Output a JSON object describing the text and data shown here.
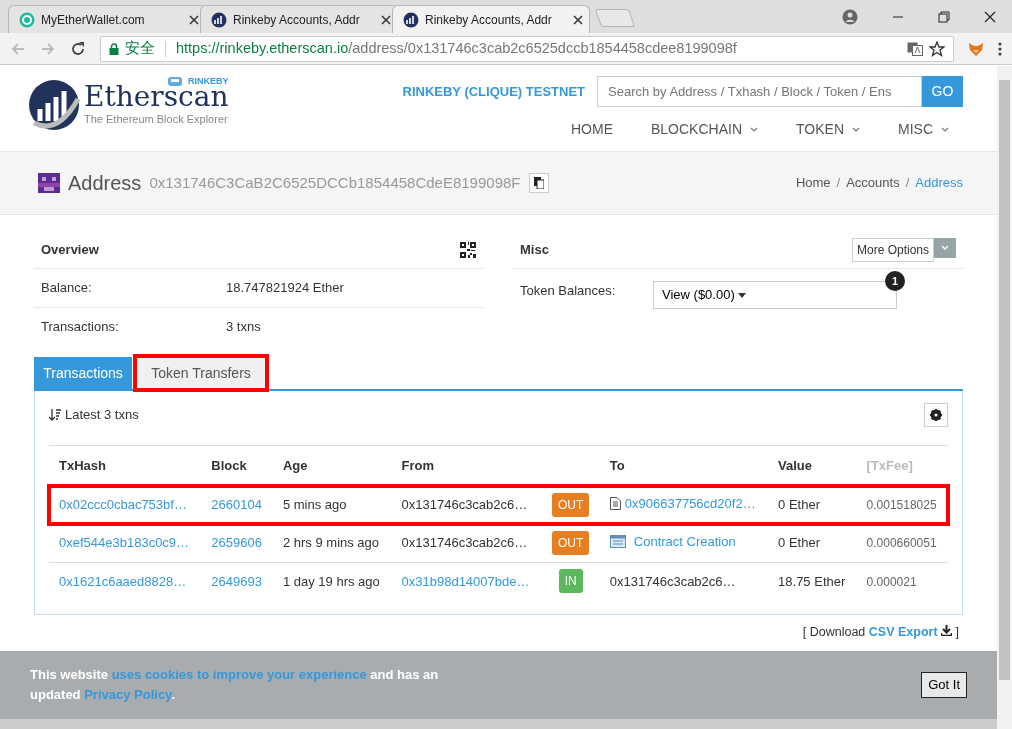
{
  "browser": {
    "tabs": [
      {
        "title": "MyEtherWallet.com",
        "selected": false,
        "kind": "wallet"
      },
      {
        "title": "Rinkeby Accounts, Addr",
        "selected": false,
        "kind": "etherscan"
      },
      {
        "title": "Rinkeby Accounts, Addr",
        "selected": true,
        "kind": "etherscan"
      }
    ],
    "secure_label": "安全",
    "url_host": "https://rinkeby.etherscan.io",
    "url_path": "/address/0x131746c3cab2c6525dccb1854458cdee8199098f"
  },
  "header": {
    "logo_text": "Etherscan",
    "logo_tagline": "The Ethereum Block Explorer",
    "network_badge": "RINKEBY",
    "network_title": "RINKEBY (CLIQUE) TESTNET",
    "search": {
      "placeholder": "Search by Address / Txhash / Block / Token / Ens"
    },
    "search_button": "GO",
    "nav": [
      {
        "label": "HOME",
        "dropdown": false
      },
      {
        "label": "BLOCKCHAIN",
        "dropdown": true
      },
      {
        "label": "TOKEN",
        "dropdown": true
      },
      {
        "label": "MISC",
        "dropdown": true
      }
    ]
  },
  "address_bar": {
    "title": "Address",
    "address": "0x131746C3CaB2C6525DCCb1854458CdeE8199098F",
    "breadcrumb_separator": "/",
    "breadcrumb": [
      {
        "label": "Home",
        "selected": false
      },
      {
        "label": "Accounts",
        "selected": false
      },
      {
        "label": "Address",
        "selected": true
      }
    ]
  },
  "overview": {
    "title": "Overview",
    "rows": [
      {
        "label": "Balance:",
        "value": "18.747821924 Ether"
      },
      {
        "label": "Transactions:",
        "value": "3 txns"
      }
    ]
  },
  "misc": {
    "title": "Misc",
    "more_button": "More Options",
    "token_label": "Token Balances:",
    "token_dropdown": "View ($0.00)",
    "token_badge": "1"
  },
  "tabs": [
    {
      "label": "Transactions",
      "selected": true,
      "highlighted": false
    },
    {
      "label": "Token Transfers",
      "selected": false,
      "highlighted": true
    }
  ],
  "transactions": {
    "summary": "Latest 3 txns",
    "columns": [
      "TxHash",
      "Block",
      "Age",
      "From",
      "To",
      "Value",
      "[TxFee]"
    ],
    "rows": [
      {
        "tx_hash": "0x02ccc0cbac753bf…",
        "block": "2660104",
        "age": "5 mins ago",
        "from": "0x131746c3cab2c6…",
        "from_link": false,
        "direction": {
          "label": "OUT",
          "kind": "out"
        },
        "to": {
          "text": "0x906637756cd20f2…",
          "kind": "contract"
        },
        "value": "0 Ether",
        "fee": "0.001518025",
        "highlighted": true
      },
      {
        "tx_hash": "0xef544e3b183c0c9…",
        "block": "2659606",
        "age": "2 hrs 9 mins ago",
        "from": "0x131746c3cab2c6…",
        "from_link": false,
        "direction": {
          "label": "OUT",
          "kind": "out"
        },
        "to": {
          "text": "Contract Creation",
          "kind": "creation"
        },
        "value": "0 Ether",
        "fee": "0.000660051",
        "highlighted": false
      },
      {
        "tx_hash": "0x1621c6aaed8828…",
        "block": "2649693",
        "age": "1 day 19 hrs ago",
        "from": "0x31b98d14007bde…",
        "from_link": true,
        "direction": {
          "label": "IN",
          "kind": "in"
        },
        "to": {
          "text": "0x131746c3cab2c6…",
          "kind": "plain"
        },
        "value": "18.75 Ether",
        "fee": "0.000021",
        "highlighted": false
      }
    ]
  },
  "csv": {
    "prefix": "[ Download",
    "link": "CSV Export",
    "suffix": "]"
  },
  "cookie": {
    "before": "This website",
    "link1": "uses cookies to improve your experience",
    "middle": "and has an updated",
    "link2": "Privacy Policy",
    "after": ".",
    "button": "Got It"
  }
}
